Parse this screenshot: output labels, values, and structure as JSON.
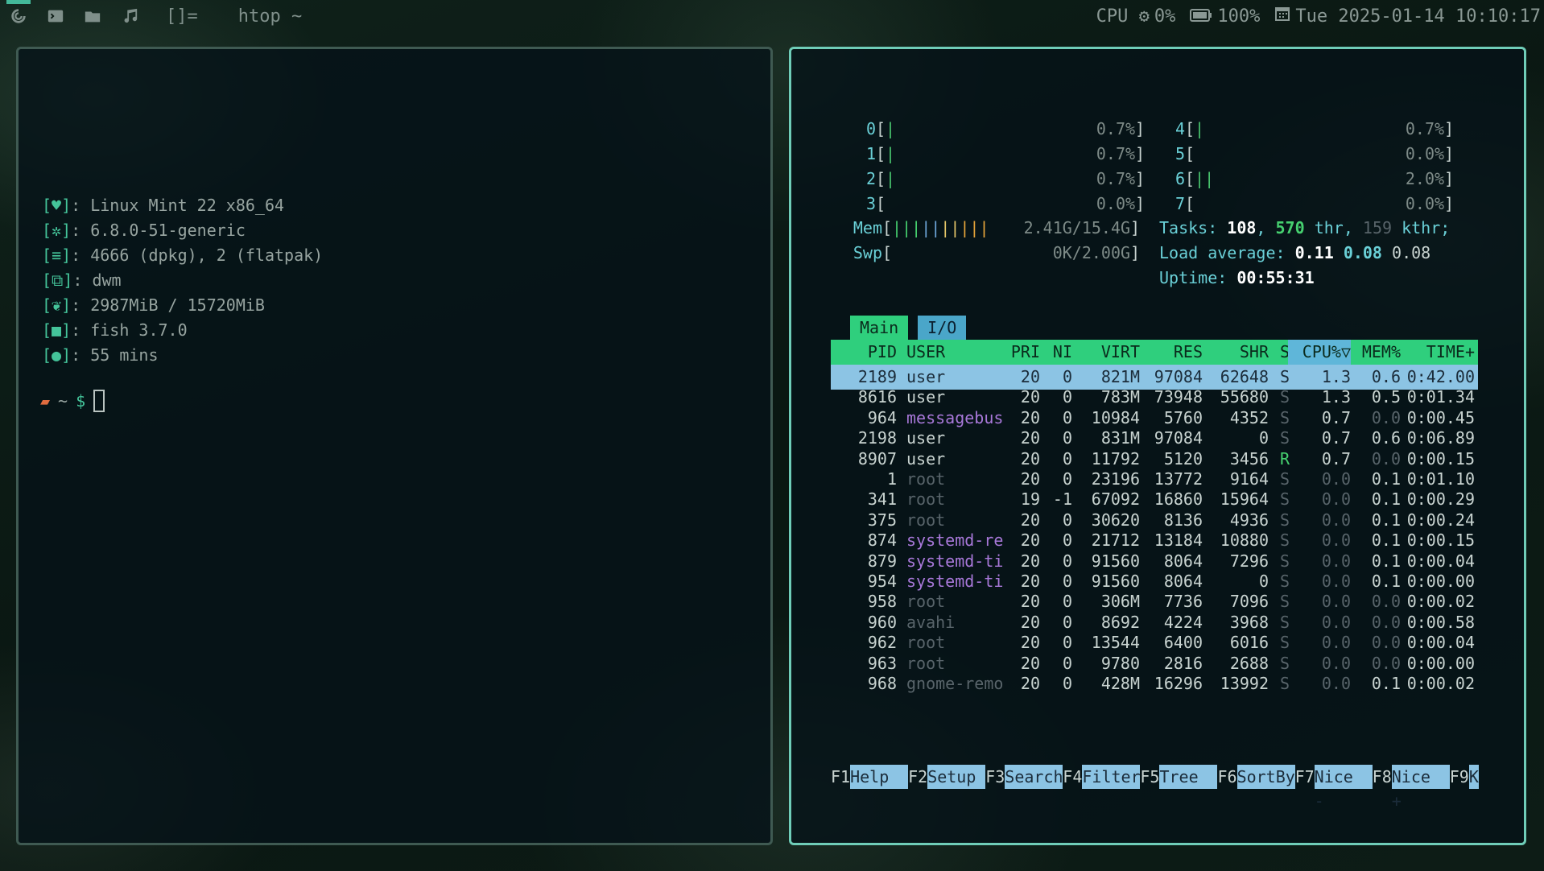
{
  "topbar": {
    "tags": [
      "tag-1-icon",
      "terminal-icon",
      "folder-icon",
      "music-icon"
    ],
    "layout": "[]=",
    "window_title": "htop ~",
    "cpu": "CPU",
    "cpu_val": "0%",
    "battery": "100%",
    "datetime": "Tue 2025-01-14 10:10:17"
  },
  "fetch": {
    "rows": [
      {
        "icon": "heart",
        "text": "Linux Mint 22 x86_64"
      },
      {
        "icon": "gear",
        "text": "6.8.0-51-generic"
      },
      {
        "icon": "package",
        "text": "4666 (dpkg), 2 (flatpak)"
      },
      {
        "icon": "windows",
        "text": "dwm"
      },
      {
        "icon": "leaf",
        "text": "2987MiB / 15720MiB"
      },
      {
        "icon": "monitor",
        "text": "fish 3.7.0"
      },
      {
        "icon": "bulb",
        "text": "55 mins"
      }
    ],
    "prompt_dir": "~",
    "prompt_sym": "$"
  },
  "htop": {
    "cpus": [
      {
        "id": "0",
        "bar": "|",
        "val": "0.7%"
      },
      {
        "id": "1",
        "bar": "|",
        "val": "0.7%"
      },
      {
        "id": "2",
        "bar": "|",
        "val": "0.7%"
      },
      {
        "id": "3",
        "bar": "",
        "val": "0.0%"
      },
      {
        "id": "4",
        "bar": "|",
        "val": "0.7%"
      },
      {
        "id": "5",
        "bar": "",
        "val": "0.0%"
      },
      {
        "id": "6",
        "bar": "||",
        "val": "2.0%"
      },
      {
        "id": "7",
        "bar": "",
        "val": "0.0%"
      }
    ],
    "mem": {
      "label": "Mem",
      "bar": "||||||||||",
      "val": "2.41G/15.4G"
    },
    "swp": {
      "label": "Swp",
      "bar": "",
      "val": "0K/2.00G"
    },
    "tasks": {
      "label": "Tasks:",
      "count": "108",
      "thr": "570",
      "thr_label": "thr",
      "kthr": "159",
      "kthr_label": "kthr;"
    },
    "load": {
      "label": "Load average:",
      "v1": "0.11",
      "v5": "0.08",
      "v15": "0.08"
    },
    "uptime": {
      "label": "Uptime:",
      "val": "00:55:31"
    },
    "tabs": [
      "Main",
      "I/O"
    ],
    "columns": [
      "PID",
      "USER",
      "PRI",
      "NI",
      "VIRT",
      "RES",
      "SHR",
      "S",
      "CPU%▽",
      "MEM%",
      "TIME+"
    ],
    "processes": [
      [
        "2189",
        "user",
        "20",
        "0",
        "821M",
        "97084",
        "62648",
        "S",
        "1.3",
        "0.6",
        "0:42.00"
      ],
      [
        "8616",
        "user",
        "20",
        "0",
        "783M",
        "73948",
        "55680",
        "S",
        "1.3",
        "0.5",
        "0:01.34"
      ],
      [
        "964",
        "messagebus",
        "20",
        "0",
        "10984",
        "5760",
        "4352",
        "S",
        "0.7",
        "0.0",
        "0:00.45"
      ],
      [
        "2198",
        "user",
        "20",
        "0",
        "831M",
        "97084",
        "0",
        "S",
        "0.7",
        "0.6",
        "0:06.89"
      ],
      [
        "8907",
        "user",
        "20",
        "0",
        "11792",
        "5120",
        "3456",
        "R",
        "0.7",
        "0.0",
        "0:00.15"
      ],
      [
        "1",
        "root",
        "20",
        "0",
        "23196",
        "13772",
        "9164",
        "S",
        "0.0",
        "0.1",
        "0:01.10"
      ],
      [
        "341",
        "root",
        "19",
        "-1",
        "67092",
        "16860",
        "15964",
        "S",
        "0.0",
        "0.1",
        "0:00.29"
      ],
      [
        "375",
        "root",
        "20",
        "0",
        "30620",
        "8136",
        "4936",
        "S",
        "0.0",
        "0.1",
        "0:00.24"
      ],
      [
        "874",
        "systemd-re",
        "20",
        "0",
        "21712",
        "13184",
        "10880",
        "S",
        "0.0",
        "0.1",
        "0:00.15"
      ],
      [
        "879",
        "systemd-ti",
        "20",
        "0",
        "91560",
        "8064",
        "7296",
        "S",
        "0.0",
        "0.1",
        "0:00.04"
      ],
      [
        "954",
        "systemd-ti",
        "20",
        "0",
        "91560",
        "8064",
        "0",
        "S",
        "0.0",
        "0.1",
        "0:00.00"
      ],
      [
        "958",
        "root",
        "20",
        "0",
        "306M",
        "7736",
        "7096",
        "S",
        "0.0",
        "0.0",
        "0:00.02"
      ],
      [
        "960",
        "avahi",
        "20",
        "0",
        "8692",
        "4224",
        "3968",
        "S",
        "0.0",
        "0.0",
        "0:00.58"
      ],
      [
        "962",
        "root",
        "20",
        "0",
        "13544",
        "6400",
        "6016",
        "S",
        "0.0",
        "0.0",
        "0:00.04"
      ],
      [
        "963",
        "root",
        "20",
        "0",
        "9780",
        "2816",
        "2688",
        "S",
        "0.0",
        "0.0",
        "0:00.00"
      ],
      [
        "968",
        "gnome-remo",
        "20",
        "0",
        "428M",
        "16296",
        "13992",
        "S",
        "0.0",
        "0.1",
        "0:00.02"
      ]
    ],
    "fkeys": [
      {
        "key": "F1",
        "label": "Help"
      },
      {
        "key": "F2",
        "label": "Setup"
      },
      {
        "key": "F3",
        "label": "Search"
      },
      {
        "key": "F4",
        "label": "Filter"
      },
      {
        "key": "F5",
        "label": "Tree"
      },
      {
        "key": "F6",
        "label": "SortBy"
      },
      {
        "key": "F7",
        "label": "Nice -"
      },
      {
        "key": "F8",
        "label": "Nice +"
      },
      {
        "key": "F9",
        "label": "K"
      }
    ]
  }
}
